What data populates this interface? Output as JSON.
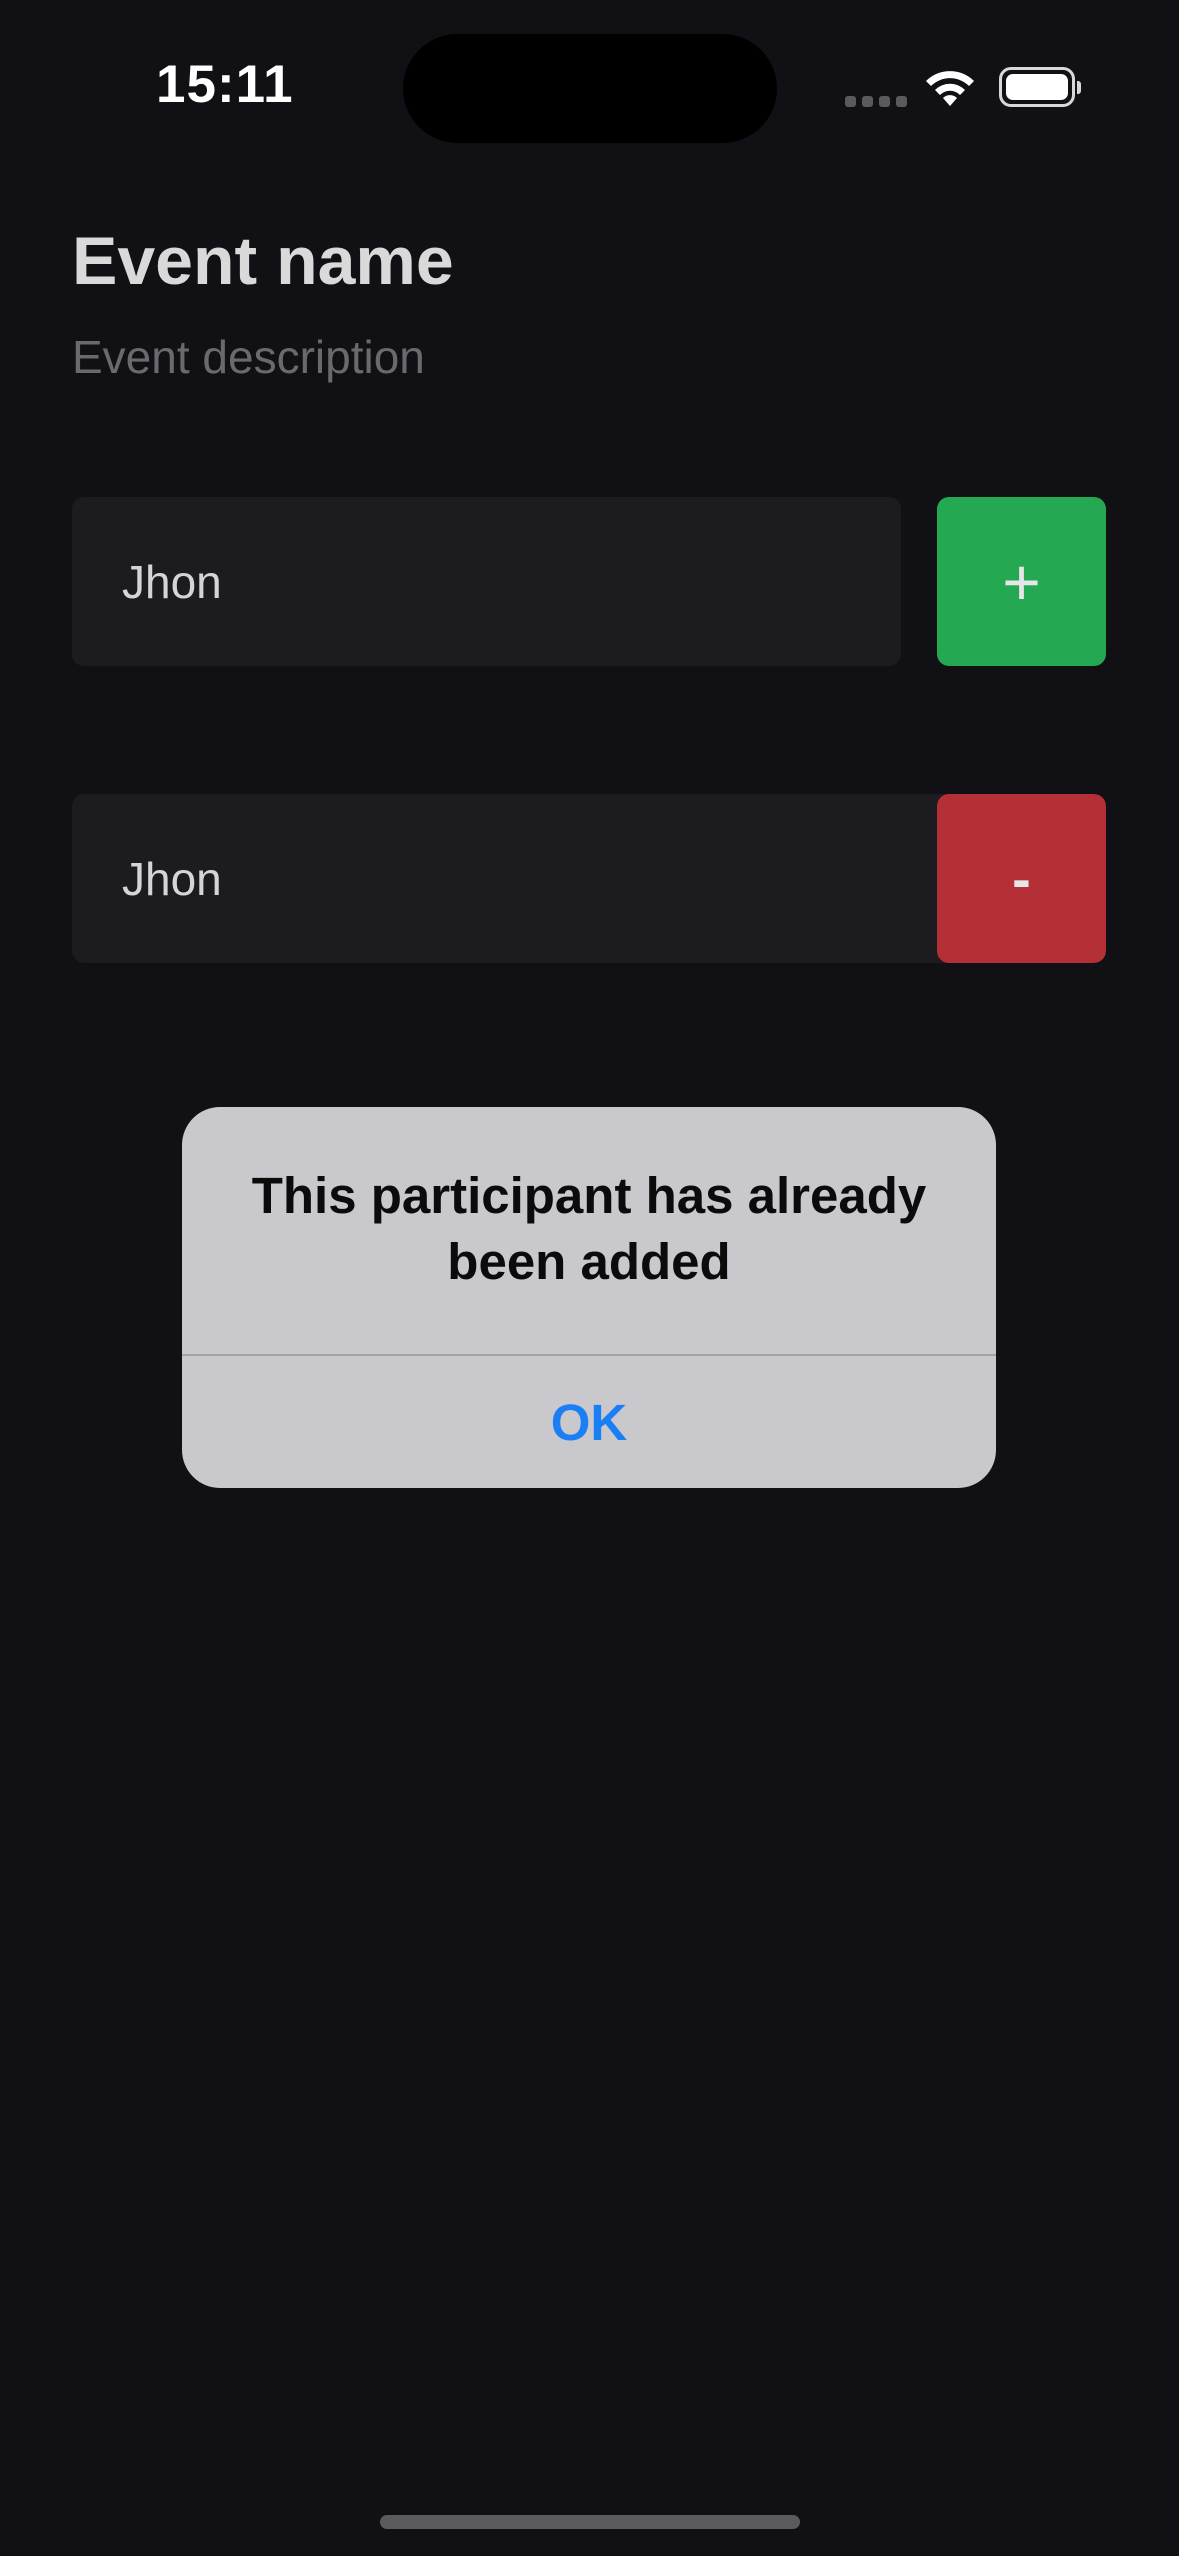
{
  "status_bar": {
    "time": "15:11",
    "icons": [
      "cellular-signal-icon",
      "wifi-icon",
      "battery-icon"
    ]
  },
  "header": {
    "title": "Event name",
    "description_placeholder": "Event description"
  },
  "add_participant": {
    "input_value": "Jhon",
    "add_label": "+"
  },
  "participants": [
    {
      "name": "Jhon",
      "remove_label": "-"
    }
  ],
  "alert": {
    "message": "This participant has already been added",
    "ok_label": "OK"
  },
  "colors": {
    "background": "#111015",
    "field_background": "#1b1b20",
    "add_button": "#24a852",
    "remove_button": "#b52f37",
    "alert_background": "#c9c8cc",
    "alert_action": "#1a7ef5"
  }
}
